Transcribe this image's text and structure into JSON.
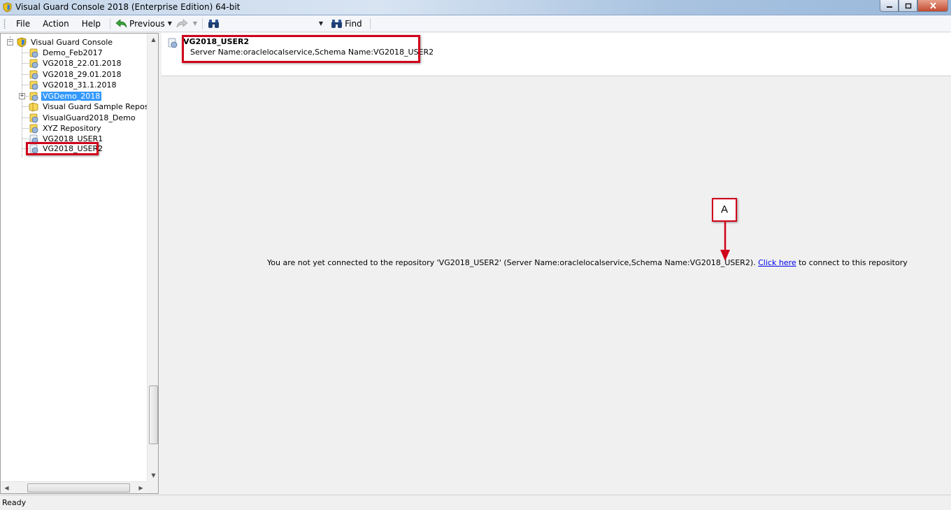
{
  "window": {
    "title": "Visual Guard Console 2018 (Enterprise Edition) 64-bit"
  },
  "menu": {
    "items": [
      "File",
      "Action",
      "Help"
    ]
  },
  "toolbar": {
    "previous_label": "Previous",
    "find_label": "Find"
  },
  "tree": {
    "root_label": "Visual Guard Console",
    "items": [
      {
        "label": "Demo_Feb2017"
      },
      {
        "label": "VG2018_22.01.2018"
      },
      {
        "label": "VG2018_29.01.2018"
      },
      {
        "label": "VG2018_31.1.2018"
      },
      {
        "label": "VGDemo_2018"
      },
      {
        "label": "Visual Guard Sample Repository"
      },
      {
        "label": "VisualGuard2018_Demo"
      },
      {
        "label": "XYZ Repository"
      },
      {
        "label": "VG2018_USER1"
      },
      {
        "label": "VG2018_USER2"
      }
    ],
    "selected_label": "VGDemo_2018"
  },
  "detail": {
    "title": "VG2018_USER2",
    "subtitle": "Server Name:oraclelocalservice,Schema Name:VG2018_USER2"
  },
  "content": {
    "message_prefix": "You are not yet connected to the repository 'VG2018_USER2' (Server Name:oraclelocalservice,Schema Name:VG2018_USER2).",
    "link_text": "Click here",
    "message_suffix": "to connect to this repository"
  },
  "annotation": {
    "callout_label": "A"
  },
  "status": {
    "text": "Ready"
  },
  "colors": {
    "selection": "#3399ff",
    "annotation_red": "#d0021b",
    "link": "#0000ee"
  }
}
